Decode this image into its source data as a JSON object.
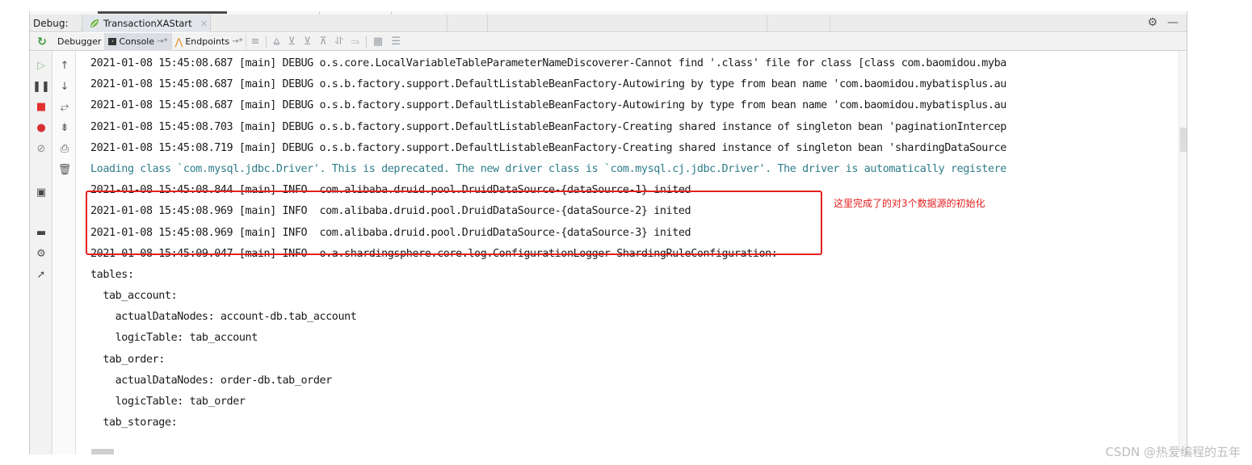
{
  "titlebar": {
    "debug_label": "Debug:",
    "run_config": "TransactionXAStart",
    "close_glyph": "×",
    "settings_glyph": "⚙",
    "minimize_glyph": "—"
  },
  "toolbar": {
    "tabs": [
      {
        "label": "Debugger"
      },
      {
        "label": "Console",
        "pin": "→*"
      },
      {
        "label": "Endpoints",
        "pin": "→*"
      }
    ]
  },
  "console": {
    "lines": [
      {
        "text": "2021-01-08 15:45:08.687 [main] DEBUG o.s.core.LocalVariableTableParameterNameDiscoverer-Cannot find '.class' file for class [class com.baomidou.myba",
        "kind": "log"
      },
      {
        "text": "2021-01-08 15:45:08.687 [main] DEBUG o.s.b.factory.support.DefaultListableBeanFactory-Autowiring by type from bean name 'com.baomidou.mybatisplus.au",
        "kind": "log"
      },
      {
        "text": "2021-01-08 15:45:08.687 [main] DEBUG o.s.b.factory.support.DefaultListableBeanFactory-Autowiring by type from bean name 'com.baomidou.mybatisplus.au",
        "kind": "log"
      },
      {
        "text": "2021-01-08 15:45:08.703 [main] DEBUG o.s.b.factory.support.DefaultListableBeanFactory-Creating shared instance of singleton bean 'paginationIntercep",
        "kind": "log"
      },
      {
        "text": "2021-01-08 15:45:08.719 [main] DEBUG o.s.b.factory.support.DefaultListableBeanFactory-Creating shared instance of singleton bean 'shardingDataSource",
        "kind": "log"
      },
      {
        "text": "Loading class `com.mysql.jdbc.Driver'. This is deprecated. The new driver class is `com.mysql.cj.jdbc.Driver'. The driver is automatically registere",
        "kind": "info"
      },
      {
        "text": "2021-01-08 15:45:08.844 [main] INFO  com.alibaba.druid.pool.DruidDataSource-{dataSource-1} inited",
        "kind": "log"
      },
      {
        "text": "2021-01-08 15:45:08.969 [main] INFO  com.alibaba.druid.pool.DruidDataSource-{dataSource-2} inited",
        "kind": "log"
      },
      {
        "text": "2021-01-08 15:45:08.969 [main] INFO  com.alibaba.druid.pool.DruidDataSource-{dataSource-3} inited",
        "kind": "log"
      },
      {
        "text": "2021-01-08 15:45:09.047 [main] INFO  o.a.shardingsphere.core.log.ConfigurationLogger-ShardingRuleConfiguration:",
        "kind": "log"
      },
      {
        "text": "tables:",
        "kind": "log"
      },
      {
        "text": "  tab_account:",
        "kind": "log"
      },
      {
        "text": "    actualDataNodes: account-db.tab_account",
        "kind": "log"
      },
      {
        "text": "    logicTable: tab_account",
        "kind": "log"
      },
      {
        "text": "  tab_order:",
        "kind": "log"
      },
      {
        "text": "    actualDataNodes: order-db.tab_order",
        "kind": "log"
      },
      {
        "text": "    logicTable: tab_order",
        "kind": "log"
      },
      {
        "text": "  tab_storage:",
        "kind": "log"
      }
    ]
  },
  "annotation": {
    "text": "这里完成了的对3个数据源的初始化",
    "color": "#e32020"
  },
  "watermark": {
    "text": "CSDN @热爱编程的五年"
  },
  "icons": {
    "left_toolbar": [
      "resume-icon",
      "pause-icon",
      "stop-icon",
      "view-breakpoints-icon",
      "mute-breakpoints-icon",
      "camera-icon",
      "layout-icon",
      "settings-icon",
      "pin-icon"
    ],
    "gutter": [
      "scroll-up-icon",
      "scroll-down-icon",
      "soft-wrap-icon",
      "scroll-to-end-icon",
      "print-icon",
      "clear-all-icon"
    ]
  }
}
